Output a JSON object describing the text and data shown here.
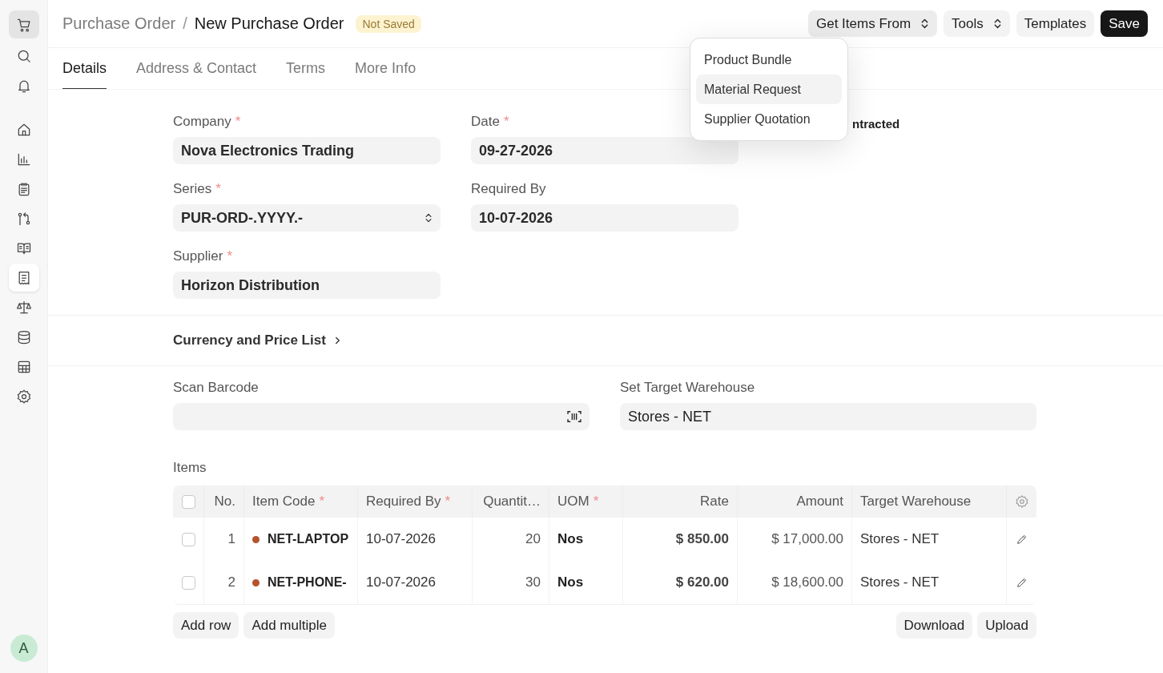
{
  "sidebar": {
    "items": [
      {
        "kind": "cart",
        "selected": true
      },
      {
        "kind": "search",
        "selected": false
      },
      {
        "kind": "bell",
        "selected": false
      },
      {
        "kind": "home",
        "selected": false
      },
      {
        "kind": "chart",
        "selected": false
      },
      {
        "kind": "clipboard",
        "selected": false
      },
      {
        "kind": "branch",
        "selected": false
      },
      {
        "kind": "book",
        "selected": false
      },
      {
        "kind": "receipt",
        "selected": true
      },
      {
        "kind": "scale",
        "selected": false
      },
      {
        "kind": "database",
        "selected": false
      },
      {
        "kind": "table",
        "selected": false
      },
      {
        "kind": "gear",
        "selected": false
      }
    ],
    "avatar": "A"
  },
  "breadcrumb": {
    "parent": "Purchase Order",
    "separator": "/",
    "title": "New Purchase Order",
    "status": "Not Saved"
  },
  "actions": [
    {
      "label": "Get Items From",
      "kind": "dropdown",
      "expanded": true,
      "menu": [
        {
          "label": "Product Bundle",
          "selected": false
        },
        {
          "label": "Material Request",
          "selected": true
        },
        {
          "label": "Supplier Quotation",
          "selected": false
        }
      ]
    },
    {
      "label": "Tools",
      "kind": "dropdown"
    },
    {
      "label": "Templates",
      "kind": "plain"
    },
    {
      "label": "Save",
      "kind": "primary"
    }
  ],
  "tabs": [
    {
      "label": "Details",
      "selected": true
    },
    {
      "label": "Address & Contact",
      "selected": false
    },
    {
      "label": "Terms",
      "selected": false
    },
    {
      "label": "More Info",
      "selected": false
    }
  ],
  "form": {
    "columns": [
      [
        {
          "label": "Company",
          "required": "*",
          "value": "Nova Electronics Trading",
          "kind": "text"
        },
        {
          "label": "Series",
          "required": "*",
          "value": "PUR-ORD-.YYYY.-",
          "kind": "select"
        },
        {
          "label": "Supplier",
          "required": "*",
          "value": "Horizon Distribution",
          "kind": "text"
        }
      ],
      [
        {
          "label": "Date",
          "required": "*",
          "value": "09-27-2026",
          "kind": "text"
        },
        {
          "label": "Required By",
          "value": "10-07-2026",
          "kind": "text"
        }
      ]
    ],
    "column_3": {
      "label_fragment": "ntracted"
    }
  },
  "section": {
    "title": "Currency and Price List",
    "expanded": false
  },
  "scan_barcode": {
    "label": "Scan Barcode"
  },
  "target_warehouse": {
    "label": "Set Target Warehouse",
    "value": "Stores - NET"
  },
  "items": {
    "label": "Items",
    "header_checked": false,
    "columns": [
      {
        "label": "No."
      },
      {
        "label": "Item Code",
        "required": "*"
      },
      {
        "label": "Required By",
        "required": "*"
      },
      {
        "label": "Quantit…"
      },
      {
        "label": "UOM",
        "required": "*"
      },
      {
        "label": "Rate"
      },
      {
        "label": "Amount"
      },
      {
        "label": "Target Warehouse"
      }
    ],
    "rows": [
      {
        "selected": false,
        "no": "1",
        "item_code": "NET-LAPTOP",
        "color": "#b5532c",
        "required_by": "10-07-2026",
        "quantity": "20",
        "uom": "Nos",
        "rate": "$ 850.00",
        "amount": "$ 17,000.00",
        "warehouse": "Stores - NET"
      },
      {
        "selected": false,
        "no": "2",
        "item_code": "NET-PHONE-",
        "color": "#b5532c",
        "required_by": "10-07-2026",
        "quantity": "30",
        "uom": "Nos",
        "rate": "$ 620.00",
        "amount": "$ 18,600.00",
        "warehouse": "Stores - NET"
      }
    ],
    "left_buttons": [
      "Add row",
      "Add multiple"
    ],
    "right_buttons": [
      "Download",
      "Upload"
    ]
  }
}
